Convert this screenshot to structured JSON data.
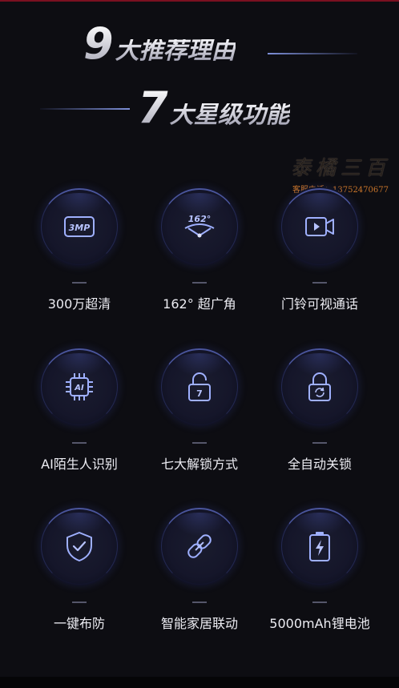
{
  "headline": {
    "line1_num": "9",
    "line1_text": "大推荐理由",
    "line2_num": "7",
    "line2_text": "大星级功能"
  },
  "watermark": {
    "brand": "泰橘三百",
    "hotline": "客服电话：13752470677"
  },
  "features": [
    {
      "label": "300万超清",
      "icon": "3mp-icon",
      "icon_text": "3MP"
    },
    {
      "label": "162°  超广角",
      "icon": "wide-angle-icon",
      "icon_text": "162°"
    },
    {
      "label": "门铃可视通话",
      "icon": "video-call-icon"
    },
    {
      "label": "AI陌生人识别",
      "icon": "ai-chip-icon",
      "icon_text": "AI"
    },
    {
      "label": "七大解锁方式",
      "icon": "unlock-icon",
      "icon_text": "7"
    },
    {
      "label": "全自动关锁",
      "icon": "auto-lock-icon"
    },
    {
      "label": "一键布防",
      "icon": "shield-check-icon"
    },
    {
      "label": "智能家居联动",
      "icon": "link-icon"
    },
    {
      "label": "5000mAh锂电池",
      "icon": "battery-icon"
    }
  ],
  "colors": {
    "background": "#0d0d12",
    "icon_stroke": "#9fb0ff",
    "watermark_phone": "#c8742a"
  }
}
